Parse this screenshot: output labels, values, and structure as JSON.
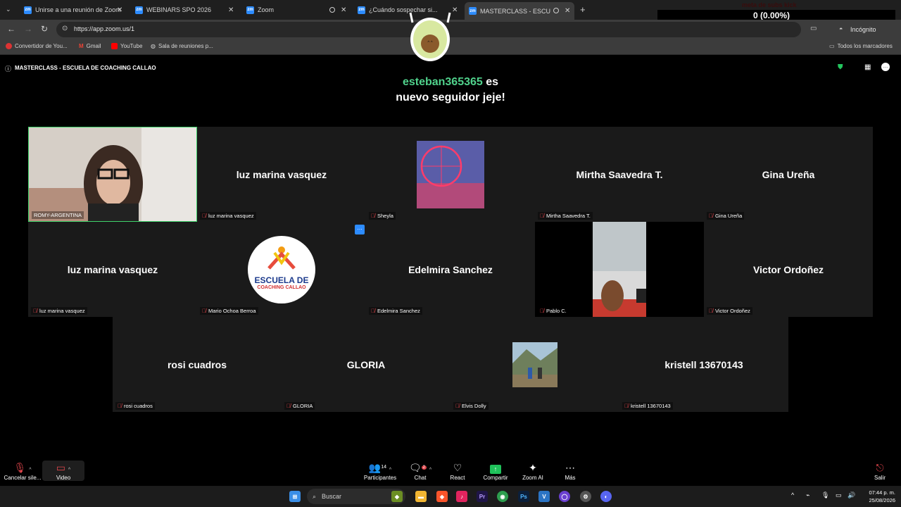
{
  "browser": {
    "tabs": [
      {
        "title": "Unirse a una reunión de Zoom"
      },
      {
        "title": "WEBINARS SPO 2026"
      },
      {
        "title": "Zoom"
      },
      {
        "title": "¿Cuándo sospechar si..."
      },
      {
        "title": "MASTERCLASS - ESCUELA I"
      }
    ],
    "url": "https://app.zoom.us/1",
    "incognito_label": "Incógnito",
    "bookmarks": [
      {
        "label": "Convertidor de You..."
      },
      {
        "label": "Gmail"
      },
      {
        "label": "YouTube"
      },
      {
        "label": "Sala de reuniones p..."
      }
    ],
    "all_bookmarks_label": "Todos los marcadores"
  },
  "overlay": {
    "subs_label": "meta de subs kick",
    "subs_count": "0 (0.00%)",
    "subs_min": "0",
    "follower_name": "esteban365365",
    "follower_suffix": "es",
    "follower_line2": "nuevo seguidor jeje!"
  },
  "meeting": {
    "title": "MASTERCLASS - ESCUELA DE COACHING CALLAO"
  },
  "participants": [
    {
      "name": "ROMY-ARGENTINA",
      "display": ""
    },
    {
      "name": "luz marina vasquez",
      "display": "luz marina vasquez"
    },
    {
      "name": "Sheyla",
      "display": ""
    },
    {
      "name": "Mirtha Saavedra T.",
      "display": "Mirtha Saavedra T."
    },
    {
      "name": "Gina Ureña",
      "display": "Gina Ureña"
    },
    {
      "name": "luz marina vasquez",
      "display": "luz marina vasquez"
    },
    {
      "name": "Mario Ochoa Berroa",
      "display": ""
    },
    {
      "name": "Edelmira Sanchez",
      "display": "Edelmira Sanchez"
    },
    {
      "name": "Pablo C.",
      "display": ""
    },
    {
      "name": "Victor Ordoñez",
      "display": "Victor Ordoñez"
    },
    {
      "name": "rosi cuadros",
      "display": "rosi cuadros"
    },
    {
      "name": "GLORIA",
      "display": "GLORIA"
    },
    {
      "name": "Elvis Dolly",
      "display": ""
    },
    {
      "name": "kristell 13670143",
      "display": "kristell 13670143"
    }
  ],
  "logo": {
    "line1": "ESCUELA DE",
    "line2": "COACHING CALLAO"
  },
  "controls": {
    "mute_label": "Cancelar sile...",
    "video_label": "Video",
    "participants_label": "Participantes",
    "participants_count": "14",
    "chat_label": "Chat",
    "chat_badge": "2",
    "react_label": "React",
    "share_label": "Compartir",
    "ai_label": "Zoom AI",
    "more_label": "Más",
    "leave_label": "Salir"
  },
  "taskbar": {
    "search_placeholder": "Buscar",
    "time": "07:44 p. m.",
    "date": "25/08/2026"
  },
  "colors": {
    "accent_green": "#50d28c",
    "zoom_blue": "#2d8cff",
    "mute_red": "#e0454b",
    "share_green": "#1fc15a"
  }
}
